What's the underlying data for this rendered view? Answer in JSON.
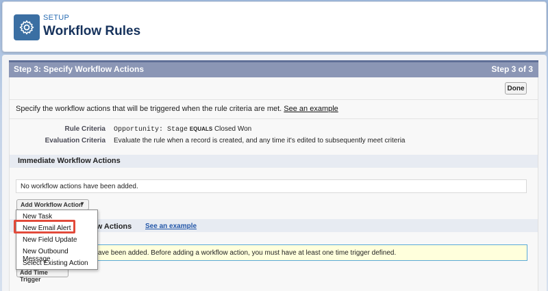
{
  "header": {
    "setup_label": "SETUP",
    "title": "Workflow Rules",
    "icon": "gear-icon"
  },
  "step": {
    "title": "Step 3: Specify Workflow Actions",
    "count": "Step 3 of 3"
  },
  "done_label": "Done",
  "description": {
    "text": "Specify the workflow actions that will be triggered when the rule criteria are met.",
    "link": "See an example"
  },
  "rule_criteria": {
    "label": "Rule Criteria",
    "field": "Opportunity: Stage",
    "operator": "EQUALS",
    "value": "Closed Won"
  },
  "evaluation_criteria": {
    "label": "Evaluation Criteria",
    "value": "Evaluate the rule when a record is created, and any time it's edited to subsequently meet criteria"
  },
  "immediate": {
    "heading": "Immediate Workflow Actions",
    "empty": "No workflow actions have been added.",
    "add_button": "Add Workflow Action",
    "add_arrow": "▼"
  },
  "time_dependent": {
    "heading_visible": "ow Actions",
    "link": "See an example",
    "warning_visible": "ave been added. Before adding a workflow action, you must have at least one time trigger defined.",
    "add_time_trigger": "Add Time Trigger"
  },
  "dropdown": {
    "items": [
      "New Task",
      "New Email Alert",
      "New Field Update",
      "New Outbound Message",
      "Select Existing Action"
    ],
    "highlighted_index": 1
  },
  "colors": {
    "step_bar": "#8b96b5",
    "icon_bg": "#3b6fa3",
    "highlight": "#e24a3a",
    "warning_bg": "#ffffdc"
  }
}
